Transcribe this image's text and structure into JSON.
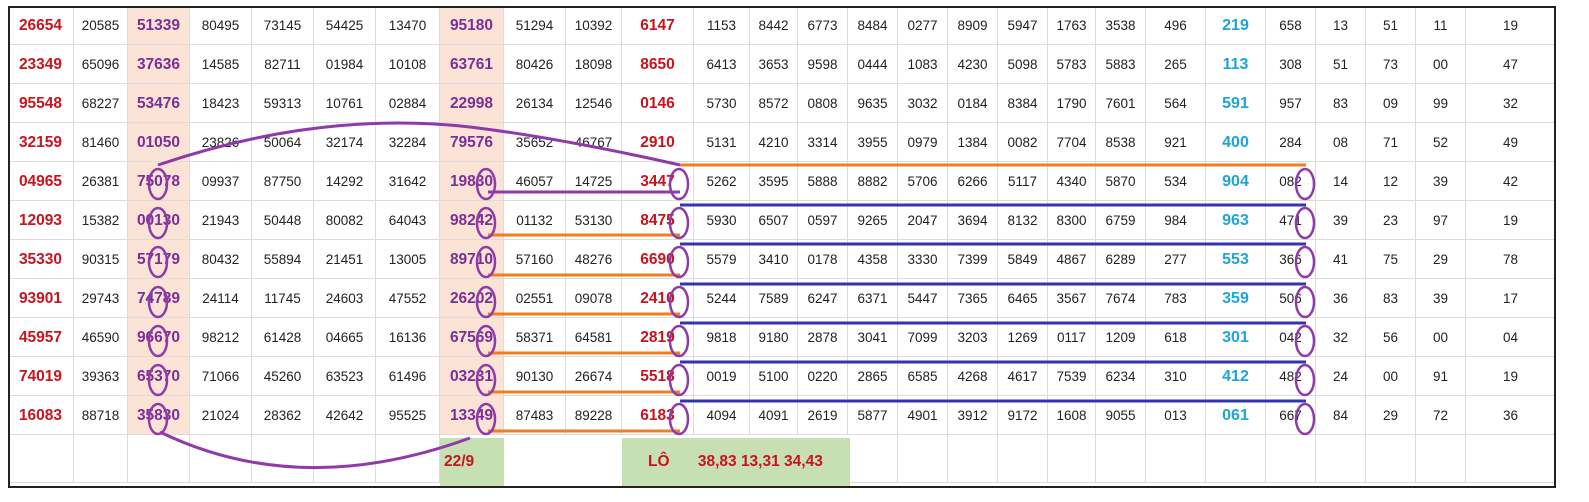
{
  "rows": [
    [
      "26654",
      "20585",
      "51339",
      "80495",
      "73145",
      "54425",
      "13470",
      "95180",
      "51294",
      "10392",
      "6147",
      "1153",
      "8442",
      "6773",
      "8484",
      "0277",
      "8909",
      "5947",
      "1763",
      "3538",
      "496",
      "219",
      "658",
      "13",
      "51",
      "11",
      "19"
    ],
    [
      "23349",
      "65096",
      "37636",
      "14585",
      "82711",
      "01984",
      "10108",
      "63761",
      "80426",
      "18098",
      "8650",
      "6413",
      "3653",
      "9598",
      "0444",
      "1083",
      "4230",
      "5098",
      "5783",
      "5883",
      "265",
      "113",
      "308",
      "51",
      "73",
      "00",
      "47"
    ],
    [
      "95548",
      "68227",
      "53476",
      "18423",
      "59313",
      "10761",
      "02884",
      "22998",
      "26134",
      "12546",
      "0146",
      "5730",
      "8572",
      "0808",
      "9635",
      "3032",
      "0184",
      "8384",
      "1790",
      "7601",
      "564",
      "591",
      "957",
      "83",
      "09",
      "99",
      "32"
    ],
    [
      "32159",
      "81460",
      "01050",
      "23826",
      "50064",
      "32174",
      "32284",
      "79576",
      "35652",
      "46767",
      "2910",
      "5131",
      "4210",
      "3314",
      "3955",
      "0979",
      "1384",
      "0082",
      "7704",
      "8538",
      "921",
      "400",
      "284",
      "08",
      "71",
      "52",
      "49"
    ],
    [
      "04965",
      "26381",
      "75078",
      "09937",
      "87750",
      "14292",
      "31642",
      "19830",
      "46057",
      "14725",
      "3447",
      "5262",
      "3595",
      "5888",
      "8882",
      "5706",
      "6266",
      "5117",
      "4340",
      "5870",
      "534",
      "904",
      "082",
      "14",
      "12",
      "39",
      "42"
    ],
    [
      "12093",
      "15382",
      "00130",
      "21943",
      "50448",
      "80082",
      "64043",
      "98242",
      "01132",
      "53130",
      "8475",
      "5930",
      "6507",
      "0597",
      "9265",
      "2047",
      "3694",
      "8132",
      "8300",
      "6759",
      "984",
      "963",
      "471",
      "39",
      "23",
      "97",
      "19"
    ],
    [
      "35330",
      "90315",
      "57179",
      "80432",
      "55894",
      "21451",
      "13005",
      "89710",
      "57160",
      "48276",
      "6690",
      "5579",
      "3410",
      "0178",
      "4358",
      "3330",
      "7399",
      "5849",
      "4867",
      "6289",
      "277",
      "553",
      "366",
      "41",
      "75",
      "29",
      "78"
    ],
    [
      "93901",
      "29743",
      "74789",
      "24114",
      "11745",
      "24603",
      "47552",
      "26202",
      "02551",
      "09078",
      "2410",
      "5244",
      "7589",
      "6247",
      "6371",
      "5447",
      "7365",
      "6465",
      "3567",
      "7674",
      "783",
      "359",
      "506",
      "36",
      "83",
      "39",
      "17"
    ],
    [
      "45957",
      "46590",
      "96670",
      "98212",
      "61428",
      "04665",
      "16136",
      "67569",
      "58371",
      "64581",
      "2819",
      "9818",
      "9180",
      "2878",
      "3041",
      "7099",
      "3203",
      "1269",
      "0117",
      "1209",
      "618",
      "301",
      "042",
      "32",
      "56",
      "00",
      "04"
    ],
    [
      "74019",
      "39363",
      "65370",
      "71066",
      "45260",
      "63523",
      "61496",
      "03231",
      "90130",
      "26674",
      "5518",
      "0019",
      "5100",
      "0220",
      "2865",
      "6585",
      "4268",
      "4617",
      "7539",
      "6234",
      "310",
      "412",
      "482",
      "24",
      "00",
      "91",
      "19"
    ],
    [
      "16083",
      "88718",
      "35830",
      "21024",
      "28362",
      "42642",
      "95525",
      "13349",
      "87483",
      "89228",
      "6183",
      "4094",
      "4091",
      "2619",
      "5877",
      "4901",
      "3912",
      "9172",
      "1608",
      "9055",
      "013",
      "061",
      "667",
      "84",
      "29",
      "72",
      "36"
    ]
  ],
  "footer": {
    "date_label": "22/9",
    "lo_label": "LÔ",
    "lo_values": "38,83 13,31 34,43"
  }
}
